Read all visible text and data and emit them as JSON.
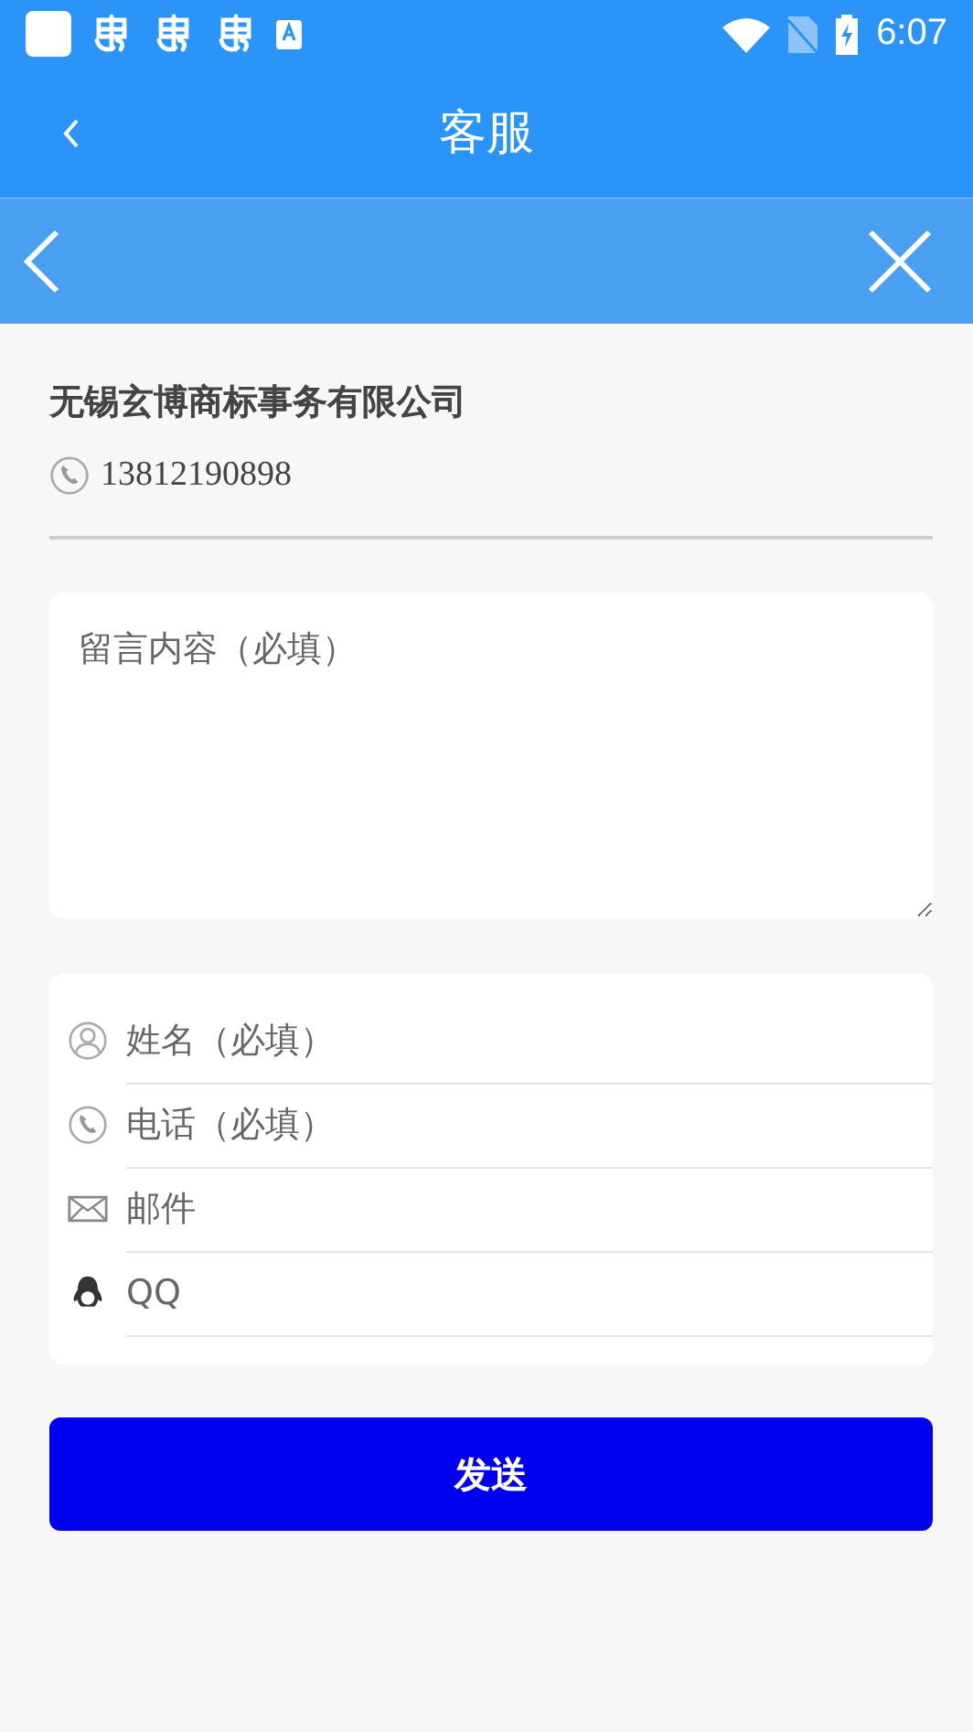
{
  "status_bar": {
    "time": "6:07"
  },
  "app_bar": {
    "title": "客服"
  },
  "web_toolbar": {
    "back": true,
    "close": true
  },
  "company": {
    "name": "无锡玄博商标事务有限公司",
    "phone": "13812190898"
  },
  "message": {
    "placeholder": "留言内容（必填）"
  },
  "fields": [
    {
      "kind": "person",
      "placeholder": "姓名（必填）"
    },
    {
      "kind": "phone",
      "placeholder": "电话（必填）"
    },
    {
      "kind": "mail",
      "placeholder": "邮件"
    },
    {
      "kind": "qq",
      "placeholder": "QQ"
    }
  ],
  "submit": {
    "label": "发送"
  }
}
